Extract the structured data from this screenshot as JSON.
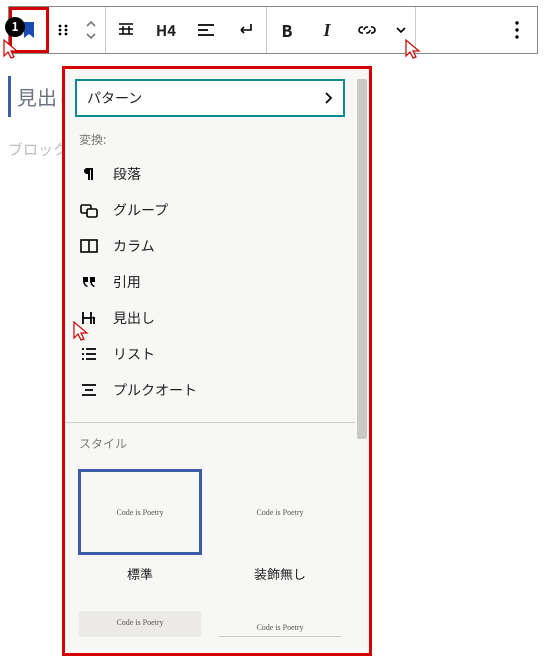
{
  "toolbar": {
    "h4": "H4"
  },
  "editor": {
    "heading_placeholder": "見出し",
    "block_placeholder": "ブロック"
  },
  "panel": {
    "pattern_label": "パターン",
    "transform_label": "変換:",
    "transforms": [
      {
        "icon": "paragraph",
        "label": "段落"
      },
      {
        "icon": "group",
        "label": "グループ"
      },
      {
        "icon": "columns",
        "label": "カラム"
      },
      {
        "icon": "quote",
        "label": "引用"
      },
      {
        "icon": "heading",
        "label": "見出し"
      },
      {
        "icon": "list",
        "label": "リスト"
      },
      {
        "icon": "pullquote",
        "label": "プルクオート"
      }
    ],
    "style_label": "スタイル",
    "styles": [
      {
        "preview": "Code is Poetry",
        "label": "標準",
        "selected": true
      },
      {
        "preview": "Code is Poetry",
        "label": "装飾無し",
        "selected": false
      }
    ],
    "styles2": [
      {
        "preview": "Code is Poetry"
      },
      {
        "preview": "Code is Poetry"
      }
    ]
  }
}
